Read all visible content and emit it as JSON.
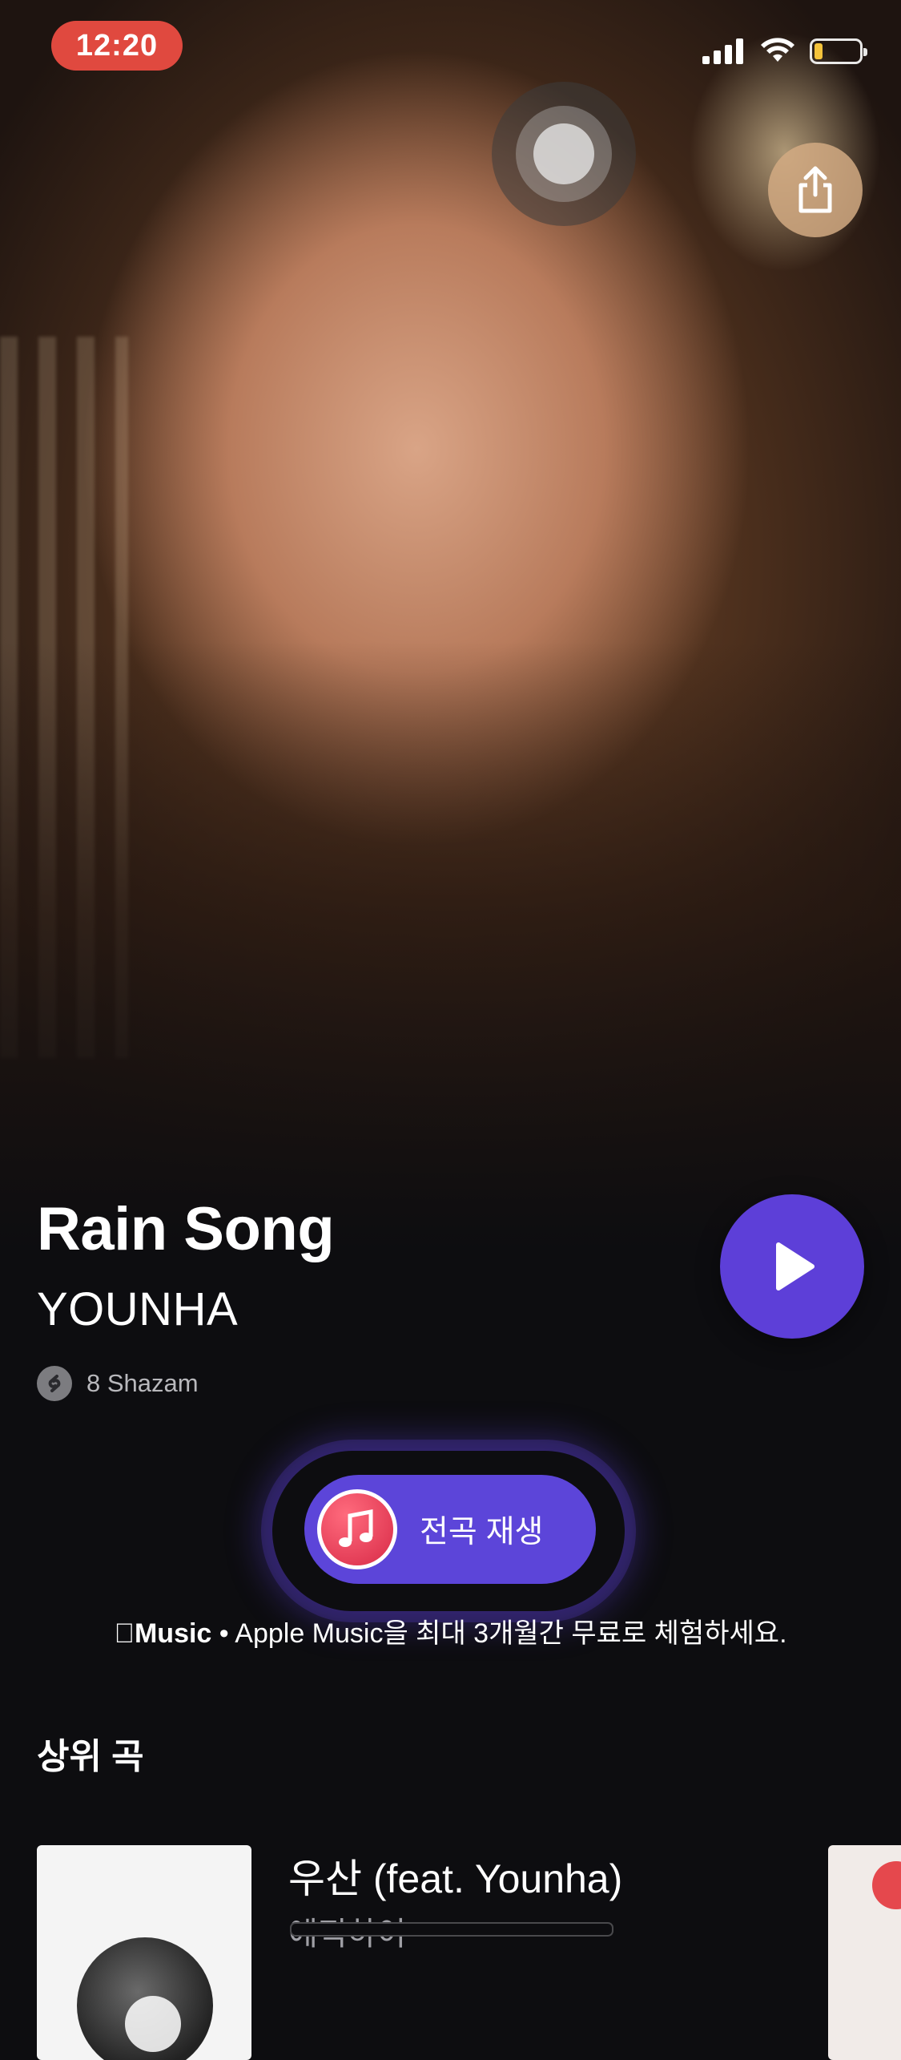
{
  "status_bar": {
    "time": "12:20",
    "icons": [
      "signal-icon",
      "wifi-icon",
      "battery-icon"
    ],
    "battery_color": "#f5c33b"
  },
  "header": {
    "share_icon": "share-icon"
  },
  "song": {
    "title": "Rain Song",
    "artist": "YOUNHA",
    "shazam_count": "8 Shazam"
  },
  "actions": {
    "play_all_label": "전곡 재생",
    "accent_color": "#5d3fd8"
  },
  "promo": {
    "brand": "Music",
    "text": " • Apple Music을 최대 3개월간 무료로 체험하세요."
  },
  "top_songs": {
    "title": "상위 곡",
    "items": [
      {
        "name": "우산 (feat. Younha)",
        "artist": "에픽하이"
      }
    ]
  }
}
